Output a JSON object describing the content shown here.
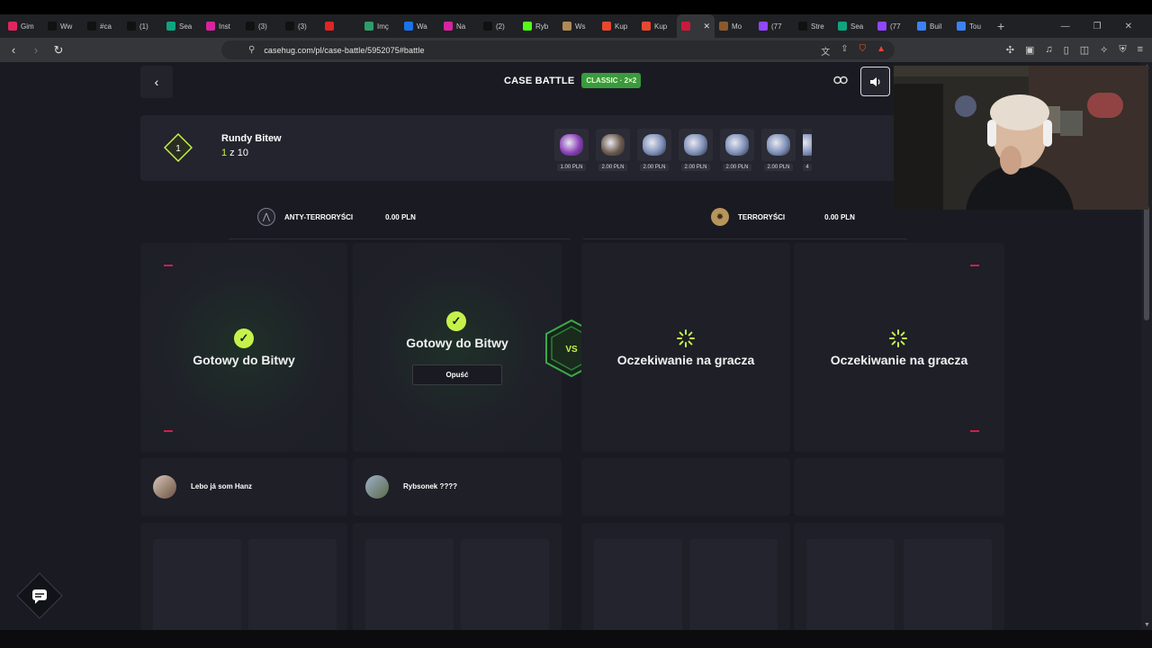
{
  "browser": {
    "tabs": [
      {
        "label": "Gim",
        "color": "#e0245e"
      },
      {
        "label": "Ww",
        "color": "#111111"
      },
      {
        "label": "#ca",
        "color": "#111111"
      },
      {
        "label": "(1)",
        "color": "#111111"
      },
      {
        "label": "Sea",
        "color": "#10a37f"
      },
      {
        "label": "Inst",
        "color": "#d6249f"
      },
      {
        "label": "(3)",
        "color": "#111111"
      },
      {
        "label": "(3)",
        "color": "#111111"
      },
      {
        "label": "",
        "color": "#e02424"
      },
      {
        "label": "Imç",
        "color": "#2e9c6a"
      },
      {
        "label": "Wa",
        "color": "#1a73e8"
      },
      {
        "label": "Na",
        "color": "#d6249f"
      },
      {
        "label": "(2)",
        "color": "#111111"
      },
      {
        "label": "Ryb",
        "color": "#53fc18"
      },
      {
        "label": "Ws",
        "color": "#b08a56"
      },
      {
        "label": "Kup",
        "color": "#e8472f"
      },
      {
        "label": "Kup",
        "color": "#e8472f"
      },
      {
        "label": "",
        "color": "#c91a3b"
      },
      {
        "label": "Mo",
        "color": "#8a5a2c"
      },
      {
        "label": "(77",
        "color": "#9146ff"
      },
      {
        "label": "Stre",
        "color": "#111111"
      },
      {
        "label": "Sea",
        "color": "#10a37f"
      },
      {
        "label": "(77",
        "color": "#9146ff"
      },
      {
        "label": "Buil",
        "color": "#3b82f6"
      },
      {
        "label": "Tou",
        "color": "#3b82f6"
      }
    ],
    "active_tab_index": 17,
    "url": "casehug.com/pl/case-battle/5952075#battle"
  },
  "header": {
    "title": "CASE BATTLE",
    "mode_badge": "CLASSIC · 2×2"
  },
  "rounds": {
    "current_round_badge": "1",
    "title": "Rundy Bitew",
    "current": "1",
    "of_text": " z 10",
    "cases": [
      {
        "price": "1.00 PLN",
        "color": "#8b3fb8"
      },
      {
        "price": "2.00 PLN",
        "color": "#6c5a4c"
      },
      {
        "price": "2.00 PLN",
        "color": "#7d8fb8"
      },
      {
        "price": "2.00 PLN",
        "color": "#7d8fb8"
      },
      {
        "price": "2.00 PLN",
        "color": "#7d8fb8"
      },
      {
        "price": "2.00 PLN",
        "color": "#7d8fb8"
      },
      {
        "price": "4",
        "color": "#7d8fb8"
      }
    ]
  },
  "teams": {
    "ct": {
      "name": "ANTY-TERRORYŚCI",
      "value": "0.00 PLN"
    },
    "t": {
      "name": "TERRORYŚCI",
      "value": "0.00 PLN"
    }
  },
  "slots": {
    "ready_text": "Gotowy do Bitwy",
    "waiting_text": "Oczekiwanie na gracza",
    "leave_label": "Opuść",
    "vs_label": "VS"
  },
  "players": [
    {
      "name": "Lebo já som Hanz"
    },
    {
      "name": "Rybsonek ????"
    }
  ],
  "colors": {
    "accent": "#c5f24a",
    "badge_green": "#3a9a3e",
    "marker_red": "#d01d4b",
    "panel": "#23242d",
    "background": "#1a1b22"
  }
}
